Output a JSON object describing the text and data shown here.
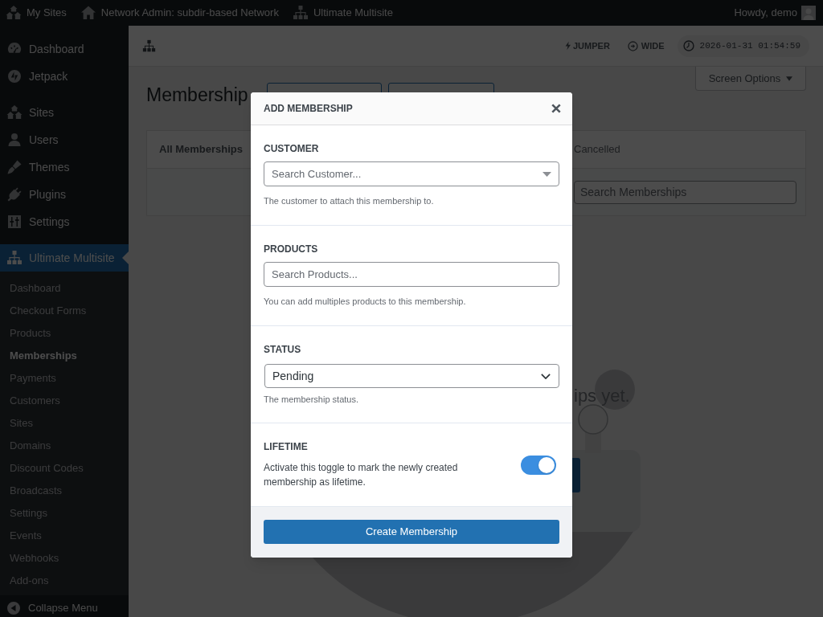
{
  "admin_bar": {
    "items": [
      {
        "label": "My Sites"
      },
      {
        "label": "Network Admin: subdir-based Network"
      },
      {
        "label": "Ultimate Multisite"
      }
    ],
    "greeting": "Howdy, demo"
  },
  "sidebar": {
    "menu_groups": [
      [
        {
          "label": "Dashboard",
          "selected": false
        },
        {
          "label": "Jetpack",
          "selected": false
        }
      ],
      [
        {
          "label": "Sites",
          "selected": false
        },
        {
          "label": "Users",
          "selected": false
        },
        {
          "label": "Themes",
          "selected": false
        },
        {
          "label": "Plugins",
          "selected": false
        },
        {
          "label": "Settings",
          "selected": false
        }
      ],
      [
        {
          "label": "Ultimate Multisite",
          "selected": true,
          "children": [
            {
              "label": "Dashboard",
              "selected": false
            },
            {
              "label": "Checkout Forms",
              "selected": false
            },
            {
              "label": "Products",
              "selected": false
            },
            {
              "label": "Memberships",
              "selected": true
            },
            {
              "label": "Payments",
              "selected": false
            },
            {
              "label": "Customers",
              "selected": false
            },
            {
              "label": "Sites",
              "selected": false
            },
            {
              "label": "Domains",
              "selected": false
            },
            {
              "label": "Discount Codes",
              "selected": false
            },
            {
              "label": "Broadcasts",
              "selected": false
            },
            {
              "label": "Settings",
              "selected": false
            },
            {
              "label": "Events",
              "selected": false
            },
            {
              "label": "Webhooks",
              "selected": false
            },
            {
              "label": "Add-ons",
              "selected": false
            }
          ]
        }
      ]
    ],
    "collapse": "Collapse Menu"
  },
  "toolbar": {
    "jumper": "JUMPER",
    "wide": "WIDE",
    "clock": "2026-01-31 01:54:59"
  },
  "page": {
    "title": "Membership",
    "screen_options": "Screen Options",
    "tabs": [
      {
        "label": "All Memberships",
        "selected": true
      },
      {
        "label": "Cancelled",
        "selected": false
      }
    ],
    "search": {
      "placeholder": "Search Memberships"
    },
    "empty_message": "ips yet."
  },
  "modal": {
    "title": "ADD MEMBERSHIP",
    "sections": [
      {
        "kind": "combobox",
        "label": "CUSTOMER",
        "placeholder": "Search Customer...",
        "help": "The customer to attach this membership to."
      },
      {
        "kind": "search",
        "label": "PRODUCTS",
        "placeholder": "Search Products...",
        "help": "You can add multiples products to this membership."
      },
      {
        "kind": "select",
        "label": "STATUS",
        "value": "Pending",
        "help": "The membership status."
      },
      {
        "kind": "toggle",
        "label": "LIFETIME",
        "description": "Activate this toggle to mark the newly created membership as lifetime.",
        "on": true
      }
    ],
    "submit": "Create Membership"
  }
}
